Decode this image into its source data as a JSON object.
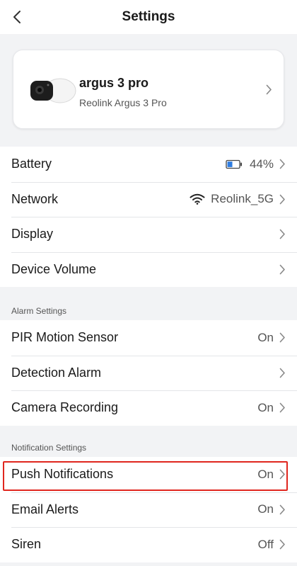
{
  "header": {
    "title": "Settings"
  },
  "device": {
    "name": "argus 3 pro",
    "model": "Reolink Argus 3 Pro"
  },
  "main_settings": {
    "battery": {
      "label": "Battery",
      "value": "44%",
      "level": 0.44
    },
    "network": {
      "label": "Network",
      "value": "Reolink_5G"
    },
    "display": {
      "label": "Display"
    },
    "device_volume": {
      "label": "Device Volume"
    }
  },
  "alarm_settings": {
    "title": "Alarm Settings",
    "pir": {
      "label": "PIR Motion Sensor",
      "value": "On"
    },
    "detection": {
      "label": "Detection Alarm"
    },
    "recording": {
      "label": "Camera Recording",
      "value": "On"
    }
  },
  "notification_settings": {
    "title": "Notification Settings",
    "push": {
      "label": "Push Notifications",
      "value": "On"
    },
    "email": {
      "label": "Email Alerts",
      "value": "On"
    },
    "siren": {
      "label": "Siren",
      "value": "Off"
    }
  },
  "colors": {
    "highlight": "#e0261e",
    "battery": "#2f7de1",
    "background": "#f2f3f5"
  }
}
